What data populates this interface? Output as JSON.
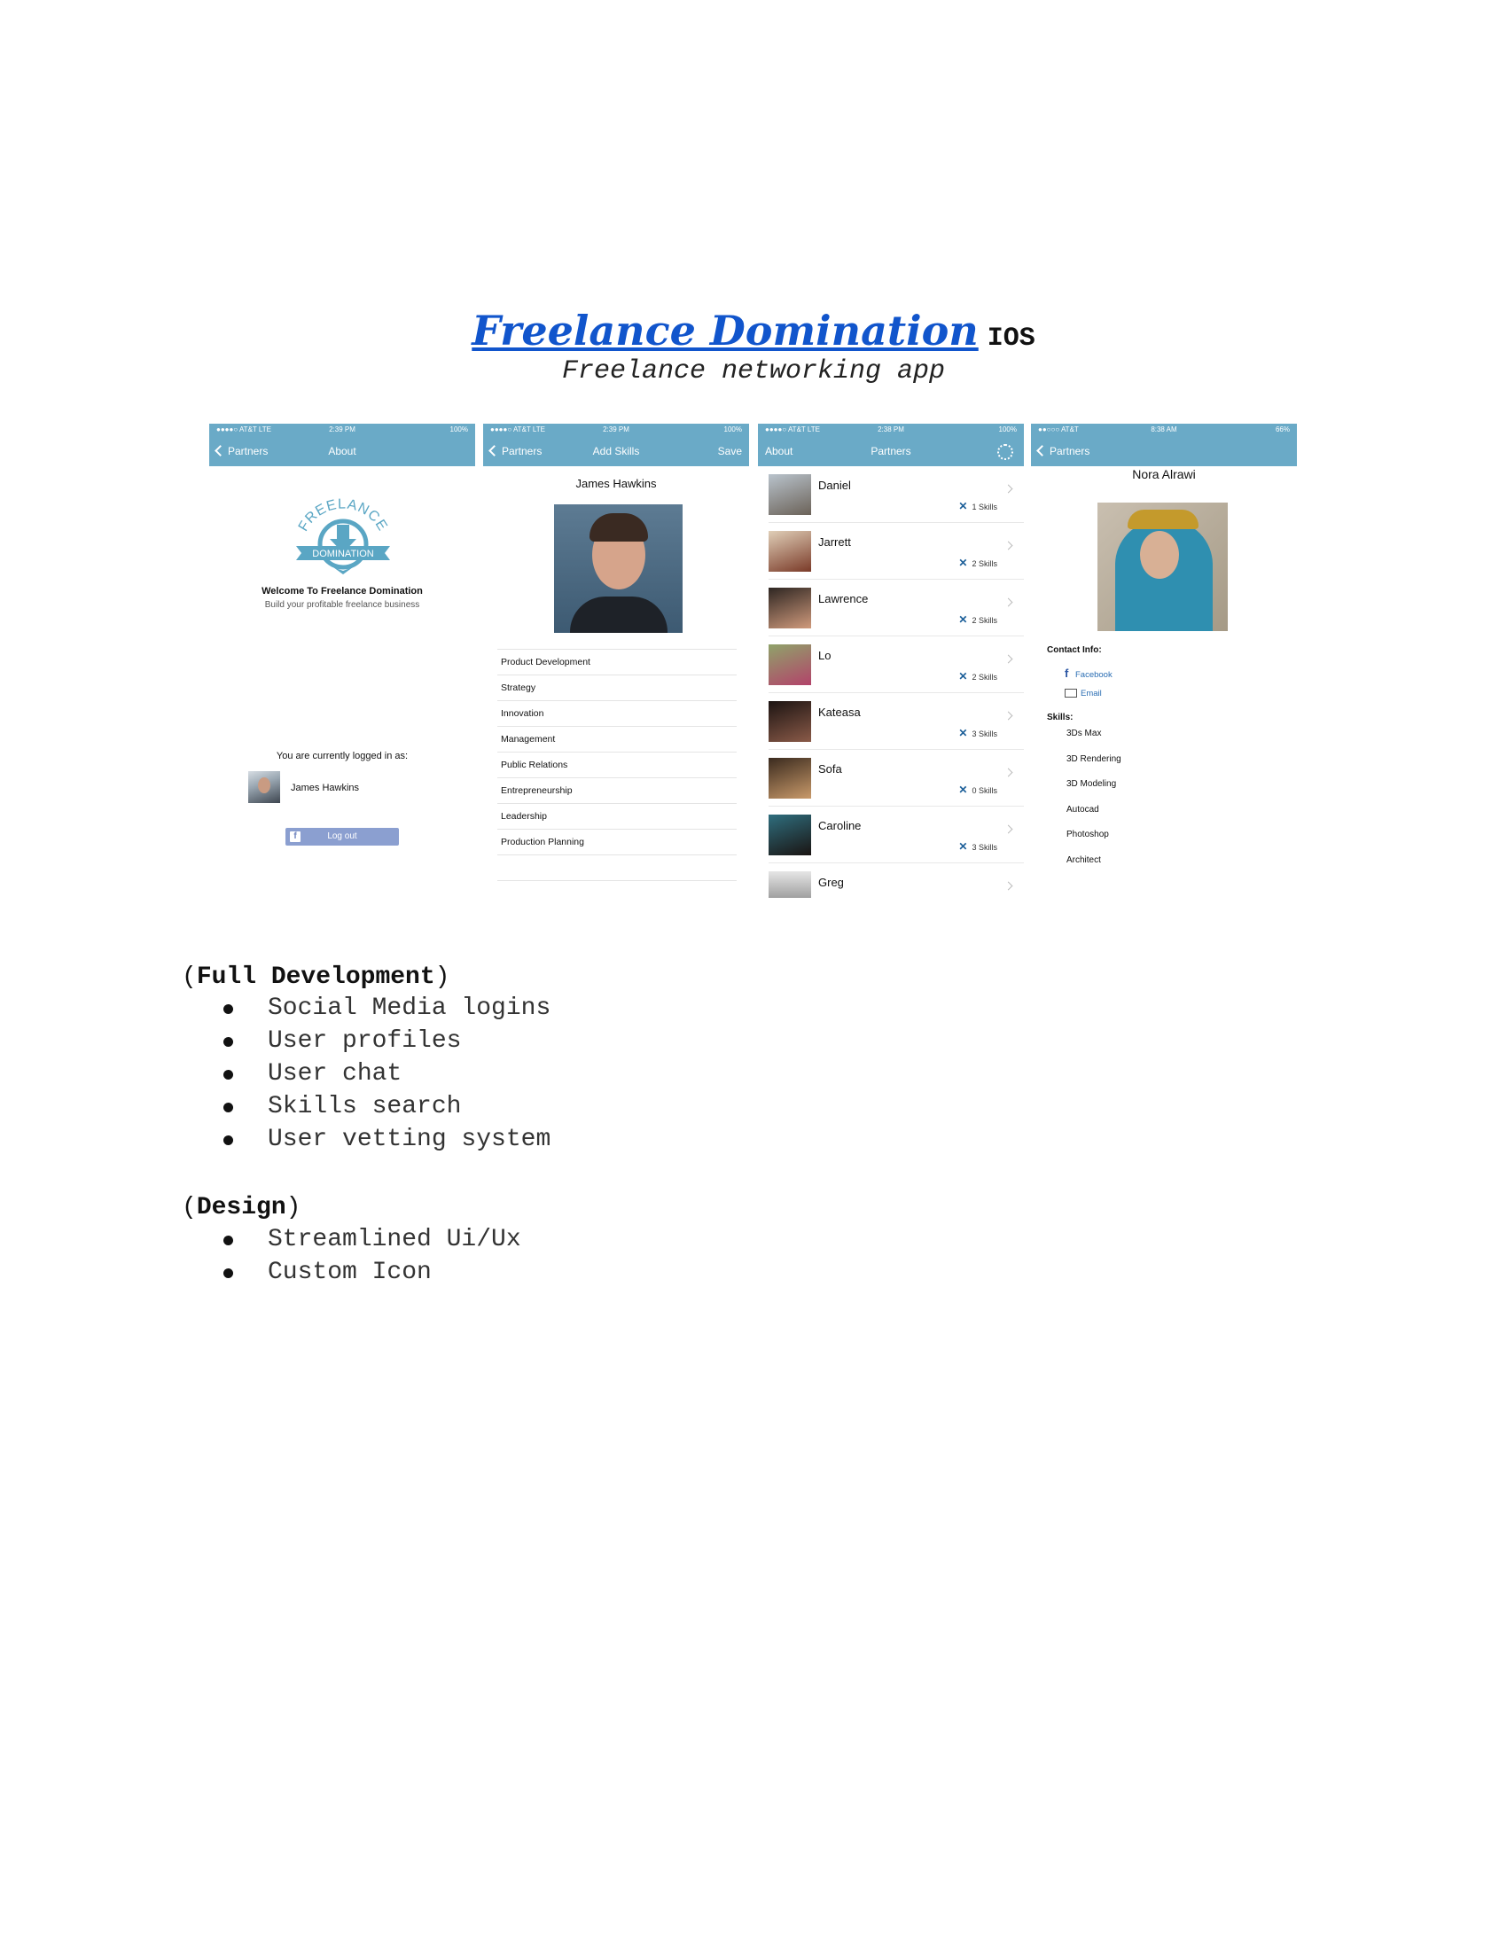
{
  "header": {
    "title": "Freelance Domination",
    "title_suffix": "IOS",
    "subtitle": "Freelance networking app"
  },
  "screens": {
    "about": {
      "status": {
        "carrier": "●●●●○ AT&T  LTE",
        "time": "2:39 PM",
        "battery": "100%"
      },
      "nav_back": "Partners",
      "nav_title": "About",
      "logo_text_top": "FREELANCE",
      "logo_text_banner": "DOMINATION",
      "welcome": "Welcome To Freelance Domination",
      "tagline": "Build your profitable freelance business",
      "logged_in_label": "You are currently logged in as:",
      "user_name": "James Hawkins",
      "logout_label": "Log out"
    },
    "add_skills": {
      "status": {
        "carrier": "●●●●○ AT&T  LTE",
        "time": "2:39 PM",
        "battery": "100%"
      },
      "nav_back": "Partners",
      "nav_title": "Add Skills",
      "nav_save": "Save",
      "profile_name": "James Hawkins",
      "skills": [
        "Product Development",
        "Strategy",
        "Innovation",
        "Management",
        "Public Relations",
        "Entrepreneurship",
        "Leadership",
        "Production Planning"
      ]
    },
    "partners": {
      "status": {
        "carrier": "●●●●○ AT&T  LTE",
        "time": "2:38 PM",
        "battery": "100%"
      },
      "nav_left": "About",
      "nav_title": "Partners",
      "settings_icon": "gear-icon",
      "items": [
        {
          "name": "Daniel",
          "skills": "1 Skills"
        },
        {
          "name": "Jarrett",
          "skills": "2 Skills"
        },
        {
          "name": "Lawrence",
          "skills": "2 Skills"
        },
        {
          "name": "Lo",
          "skills": "2 Skills"
        },
        {
          "name": "Kateasa",
          "skills": "3 Skills"
        },
        {
          "name": "Sofa",
          "skills": "0 Skills"
        },
        {
          "name": "Caroline",
          "skills": "3 Skills"
        },
        {
          "name": "Greg",
          "skills": ""
        }
      ]
    },
    "profile": {
      "status": {
        "carrier": "●●○○○ AT&T",
        "time": "8:38 AM",
        "battery": "66%"
      },
      "nav_back": "Partners",
      "name": "Nora Alrawi",
      "contact_label": "Contact Info:",
      "facebook_label": "Facebook",
      "email_label": "Email",
      "skills_label": "Skills:",
      "skills": [
        "3Ds Max",
        "3D Rendering",
        "3D Modeling",
        "Autocad",
        "Photoshop",
        "Architect"
      ]
    }
  },
  "full_development": {
    "heading_open": "(",
    "heading": "Full Development",
    "heading_close": ")",
    "items": [
      "Social Media logins",
      "User profiles",
      "User chat",
      "Skills search",
      "User vetting system"
    ]
  },
  "design": {
    "heading_open": "(",
    "heading": "Design",
    "heading_close": ")",
    "items": [
      "Streamlined Ui/Ux",
      "Custom Icon"
    ]
  },
  "colors": {
    "title_link": "#1155cc",
    "nav_bar": "#6aaac7",
    "skill_tool": "#1c5f99"
  }
}
